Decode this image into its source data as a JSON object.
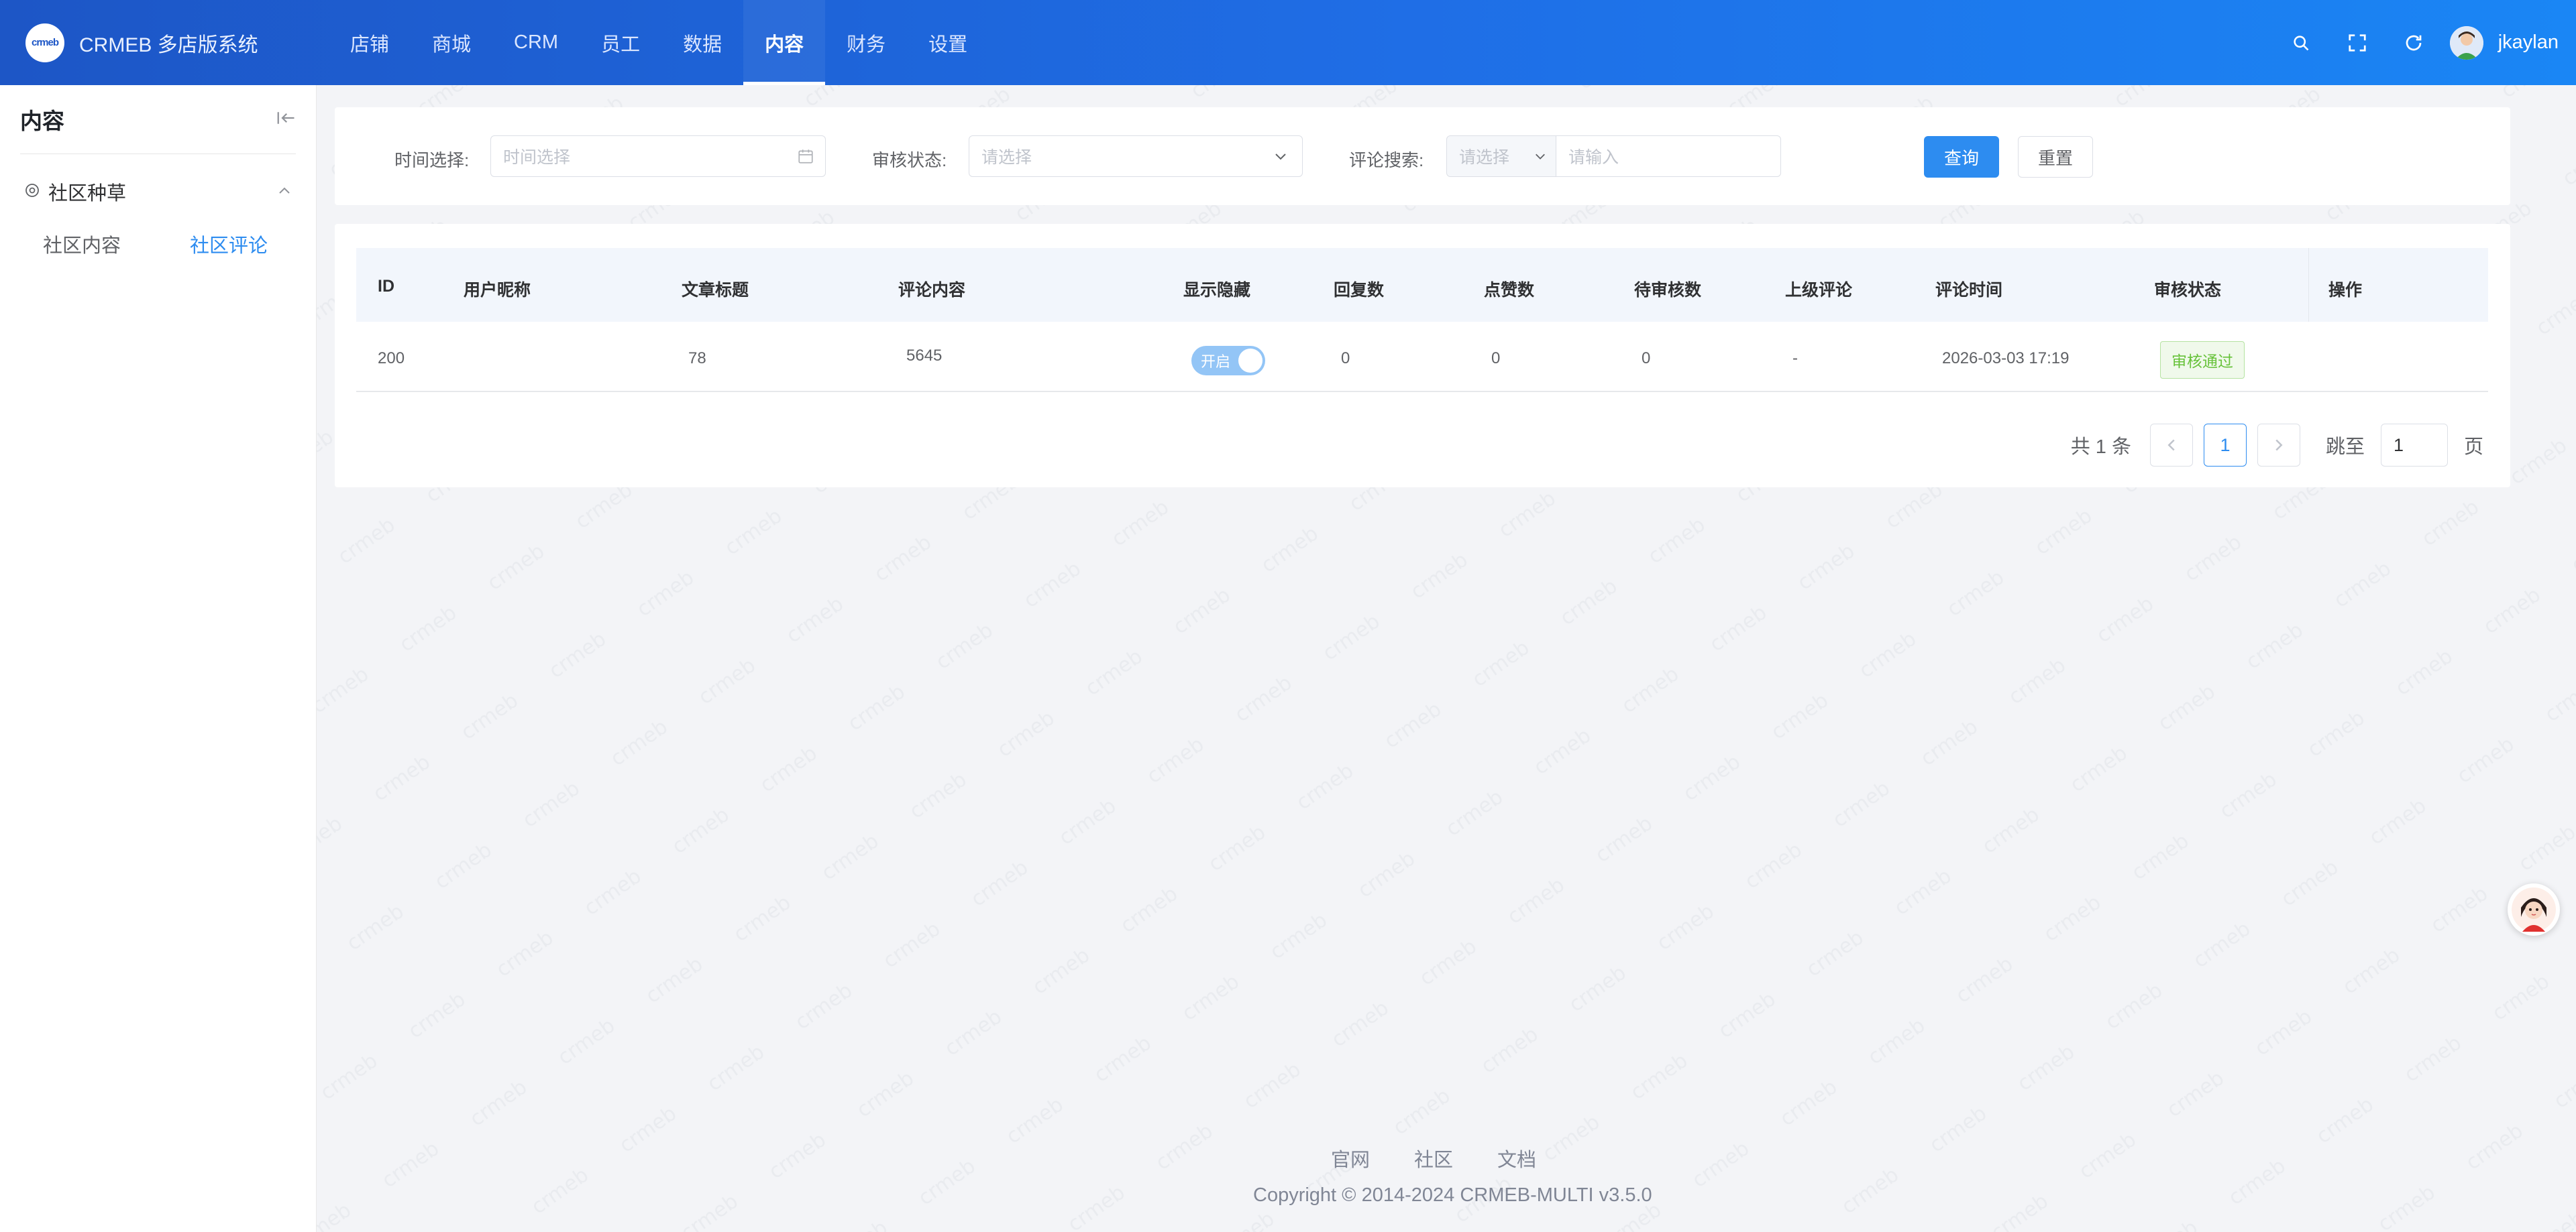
{
  "app": {
    "logo_text": "crmeb",
    "title": "CRMEB 多店版系统"
  },
  "nav": [
    {
      "label": "店铺"
    },
    {
      "label": "商城"
    },
    {
      "label": "CRM"
    },
    {
      "label": "员工"
    },
    {
      "label": "数据"
    },
    {
      "label": "内容",
      "active": true
    },
    {
      "label": "财务"
    },
    {
      "label": "设置"
    }
  ],
  "header": {
    "username": "jkaylan",
    "icons": [
      "search-icon",
      "fullscreen-icon",
      "refresh-icon"
    ]
  },
  "sidebar": {
    "title": "内容",
    "group": {
      "label": "社区种草",
      "expanded": true
    },
    "items": [
      {
        "label": "社区内容"
      },
      {
        "label": "社区评论",
        "active": true
      }
    ]
  },
  "filters": {
    "time": {
      "label": "时间选择:",
      "placeholder": "时间选择"
    },
    "status": {
      "label": "审核状态:",
      "placeholder": "请选择"
    },
    "search": {
      "label": "评论搜索:",
      "select_placeholder": "请选择",
      "input_placeholder": "请输入"
    },
    "query_button": "查询",
    "reset_button": "重置"
  },
  "table": {
    "columns": [
      "ID",
      "用户昵称",
      "文章标题",
      "评论内容",
      "显示隐藏",
      "回复数",
      "点赞数",
      "待审核数",
      "上级评论",
      "评论时间",
      "审核状态",
      "操作"
    ],
    "rows": [
      {
        "id": "200",
        "nickname": "",
        "article_title": "78",
        "content": "5645",
        "visible": {
          "on": true,
          "label": "开启"
        },
        "replies": "0",
        "likes": "0",
        "pending": "0",
        "parent": "-",
        "time": "2026-03-03 17:19",
        "status": "审核通过",
        "actions": ""
      }
    ]
  },
  "pagination": {
    "total_text": "共 1 条",
    "current_page": "1",
    "jump_label": "跳至",
    "jump_value": "1",
    "page_suffix": "页"
  },
  "footer": {
    "links": [
      "官网",
      "社区",
      "文档"
    ],
    "copyright": "Copyright © 2014-2024 CRMEB-MULTI v3.5.0"
  },
  "colors": {
    "primary": "#2d8cf0",
    "header_start": "#1d56c6",
    "header_end": "#1a86f5",
    "success": "#67c23a"
  }
}
